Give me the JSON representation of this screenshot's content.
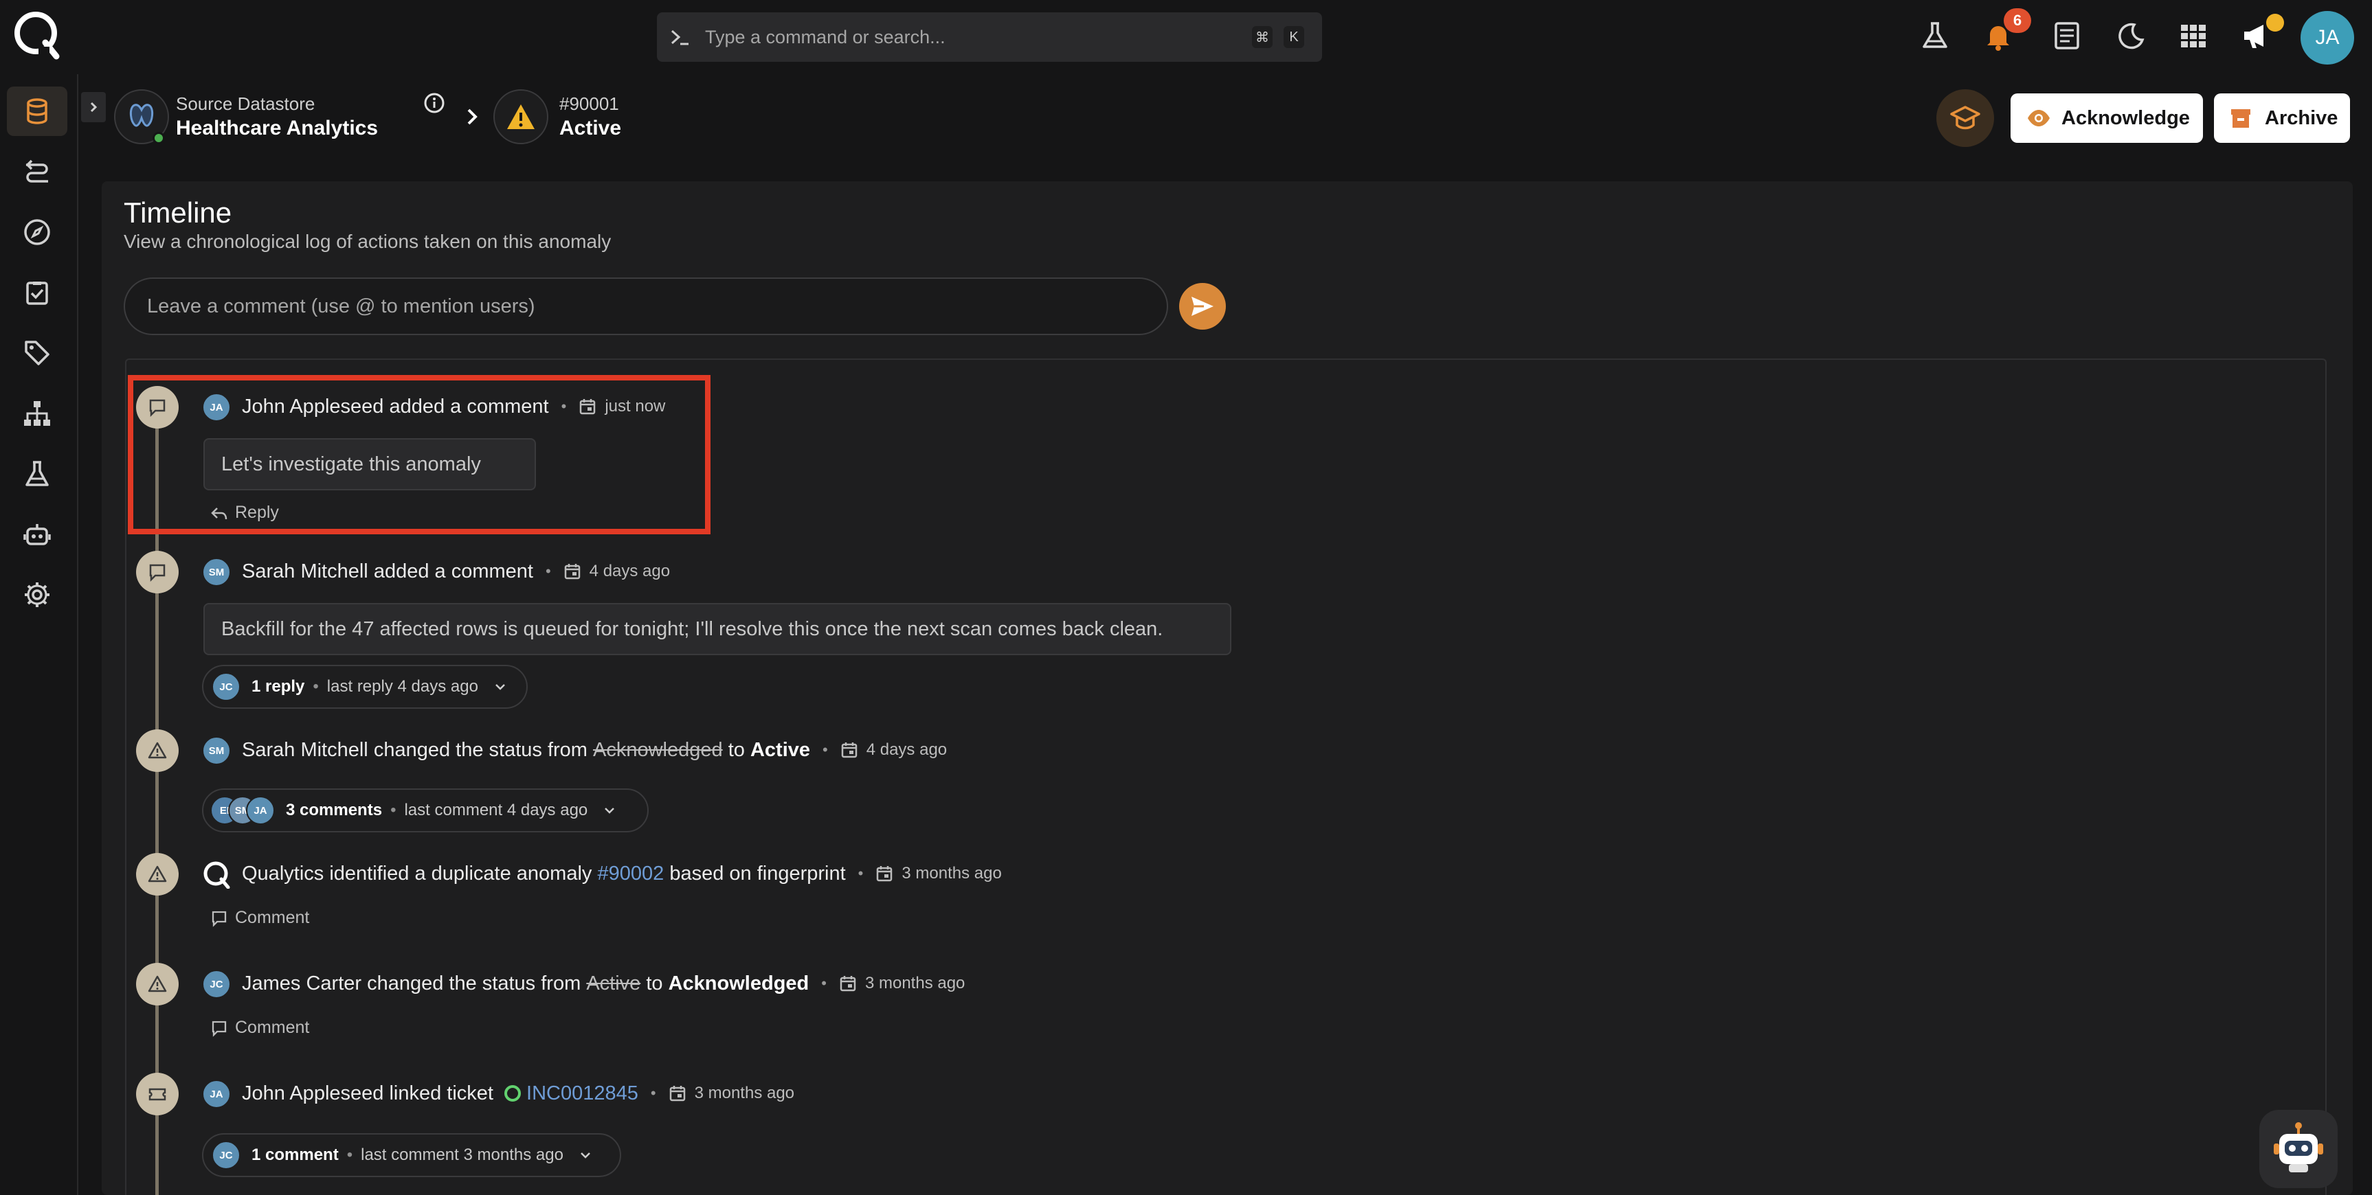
{
  "topbar": {
    "search_placeholder": "Type a command or search...",
    "shortcut_cmd": "⌘",
    "shortcut_key": "K",
    "notification_count": "6",
    "user_initials": "JA"
  },
  "breadcrumb": {
    "datastore_label": "Source Datastore",
    "datastore_name": "Healthcare Analytics",
    "anomaly_id": "#90001",
    "anomaly_status": "Active"
  },
  "actions": {
    "acknowledge": "Acknowledge",
    "archive": "Archive"
  },
  "timeline": {
    "title": "Timeline",
    "subtitle": "View a chronological log of actions taken on this anomaly",
    "comment_placeholder": "Leave a comment (use @ to mention users)"
  },
  "events": [
    {
      "initials": "JA",
      "actor": "John Appleseed",
      "action": "added a comment",
      "time": "just now",
      "comment": "Let's investigate this anomaly",
      "reply_label": "Reply"
    },
    {
      "initials": "SM",
      "actor": "Sarah Mitchell",
      "action": "added a comment",
      "time": "4 days ago",
      "comment": "Backfill for the 47 affected rows is queued for tonight; I'll resolve this once the next scan comes back clean.",
      "thread_initials": "JC",
      "thread_count": "1 reply",
      "thread_last": "last reply 4 days ago"
    },
    {
      "initials": "SM",
      "actor": "Sarah Mitchell",
      "action": "changed the status from",
      "from": "Acknowledged",
      "to_word": "to",
      "to": "Active",
      "time": "4 days ago",
      "thread_initials": [
        "EI",
        "SM",
        "JA"
      ],
      "thread_count": "3 comments",
      "thread_last": "last comment 4 days ago"
    },
    {
      "actor": "Qualytics",
      "action": "identified a duplicate anomaly",
      "link": "#90002",
      "suffix": "based on fingerprint",
      "time": "3 months ago",
      "comment_label": "Comment"
    },
    {
      "initials": "JC",
      "actor": "James Carter",
      "action": "changed the status from",
      "from": "Active",
      "to_word": "to",
      "to": "Acknowledged",
      "time": "3 months ago",
      "comment_label": "Comment"
    },
    {
      "initials": "JA",
      "actor": "John Appleseed",
      "action": "linked ticket",
      "ticket": "INC0012845",
      "time": "3 months ago",
      "thread_initials": "JC",
      "thread_count": "1 comment",
      "thread_last": "last comment 3 months ago"
    }
  ],
  "colors": {
    "background": "#151516",
    "panel": "#1e1e1f",
    "accent": "#d9893a",
    "highlight": "#e23a25",
    "link": "#6f9dd6",
    "event_icon": "#c9bea8"
  },
  "sidebar_icons": [
    "database-icon",
    "flow-icon",
    "compass-icon",
    "checklist-icon",
    "tag-icon",
    "hierarchy-icon",
    "flask-icon",
    "robot-icon",
    "settings-icon"
  ]
}
